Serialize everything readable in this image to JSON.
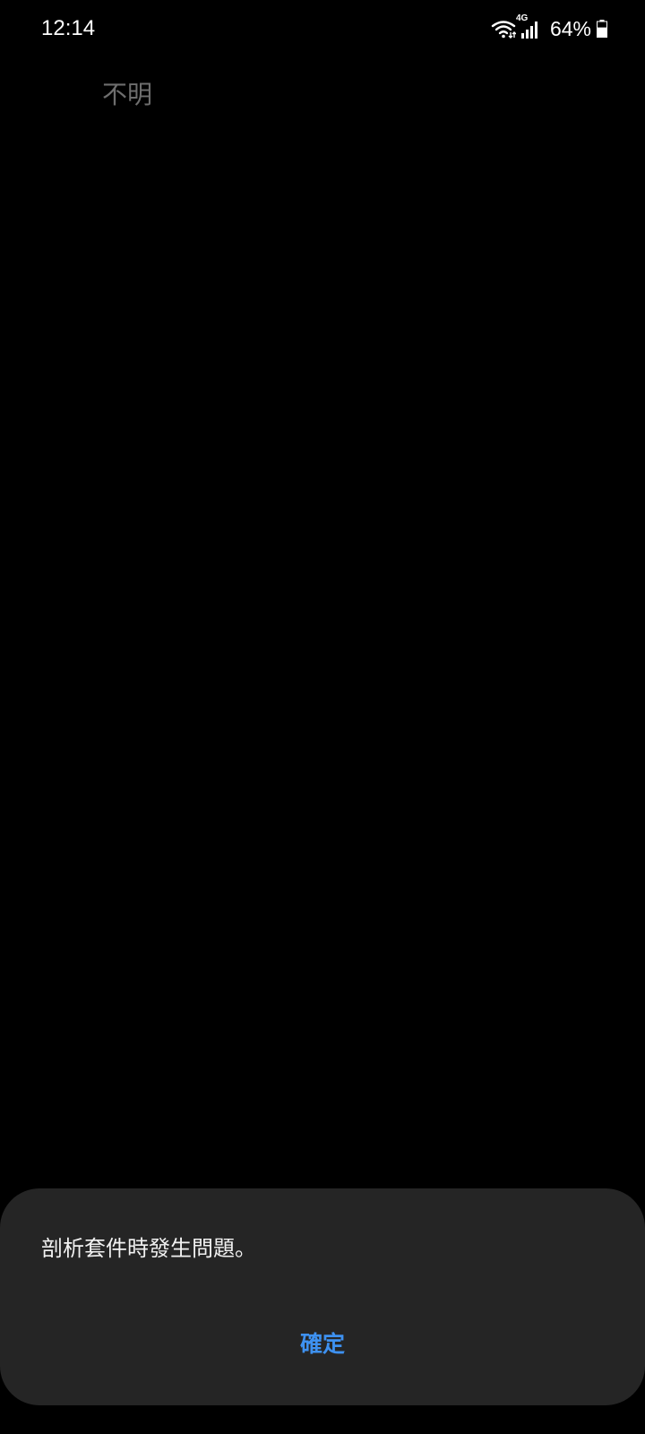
{
  "status_bar": {
    "time": "12:14",
    "network_type": "4G",
    "battery_percent": "64%",
    "battery_level": 0.64,
    "icons": [
      "wifi-icon",
      "signal-icon",
      "battery-icon"
    ]
  },
  "package": {
    "label": "不明"
  },
  "dialog": {
    "message": "剖析套件時發生問題。",
    "ok_label": "確定",
    "accent_color": "#3e91f0",
    "background_color": "#252525"
  }
}
